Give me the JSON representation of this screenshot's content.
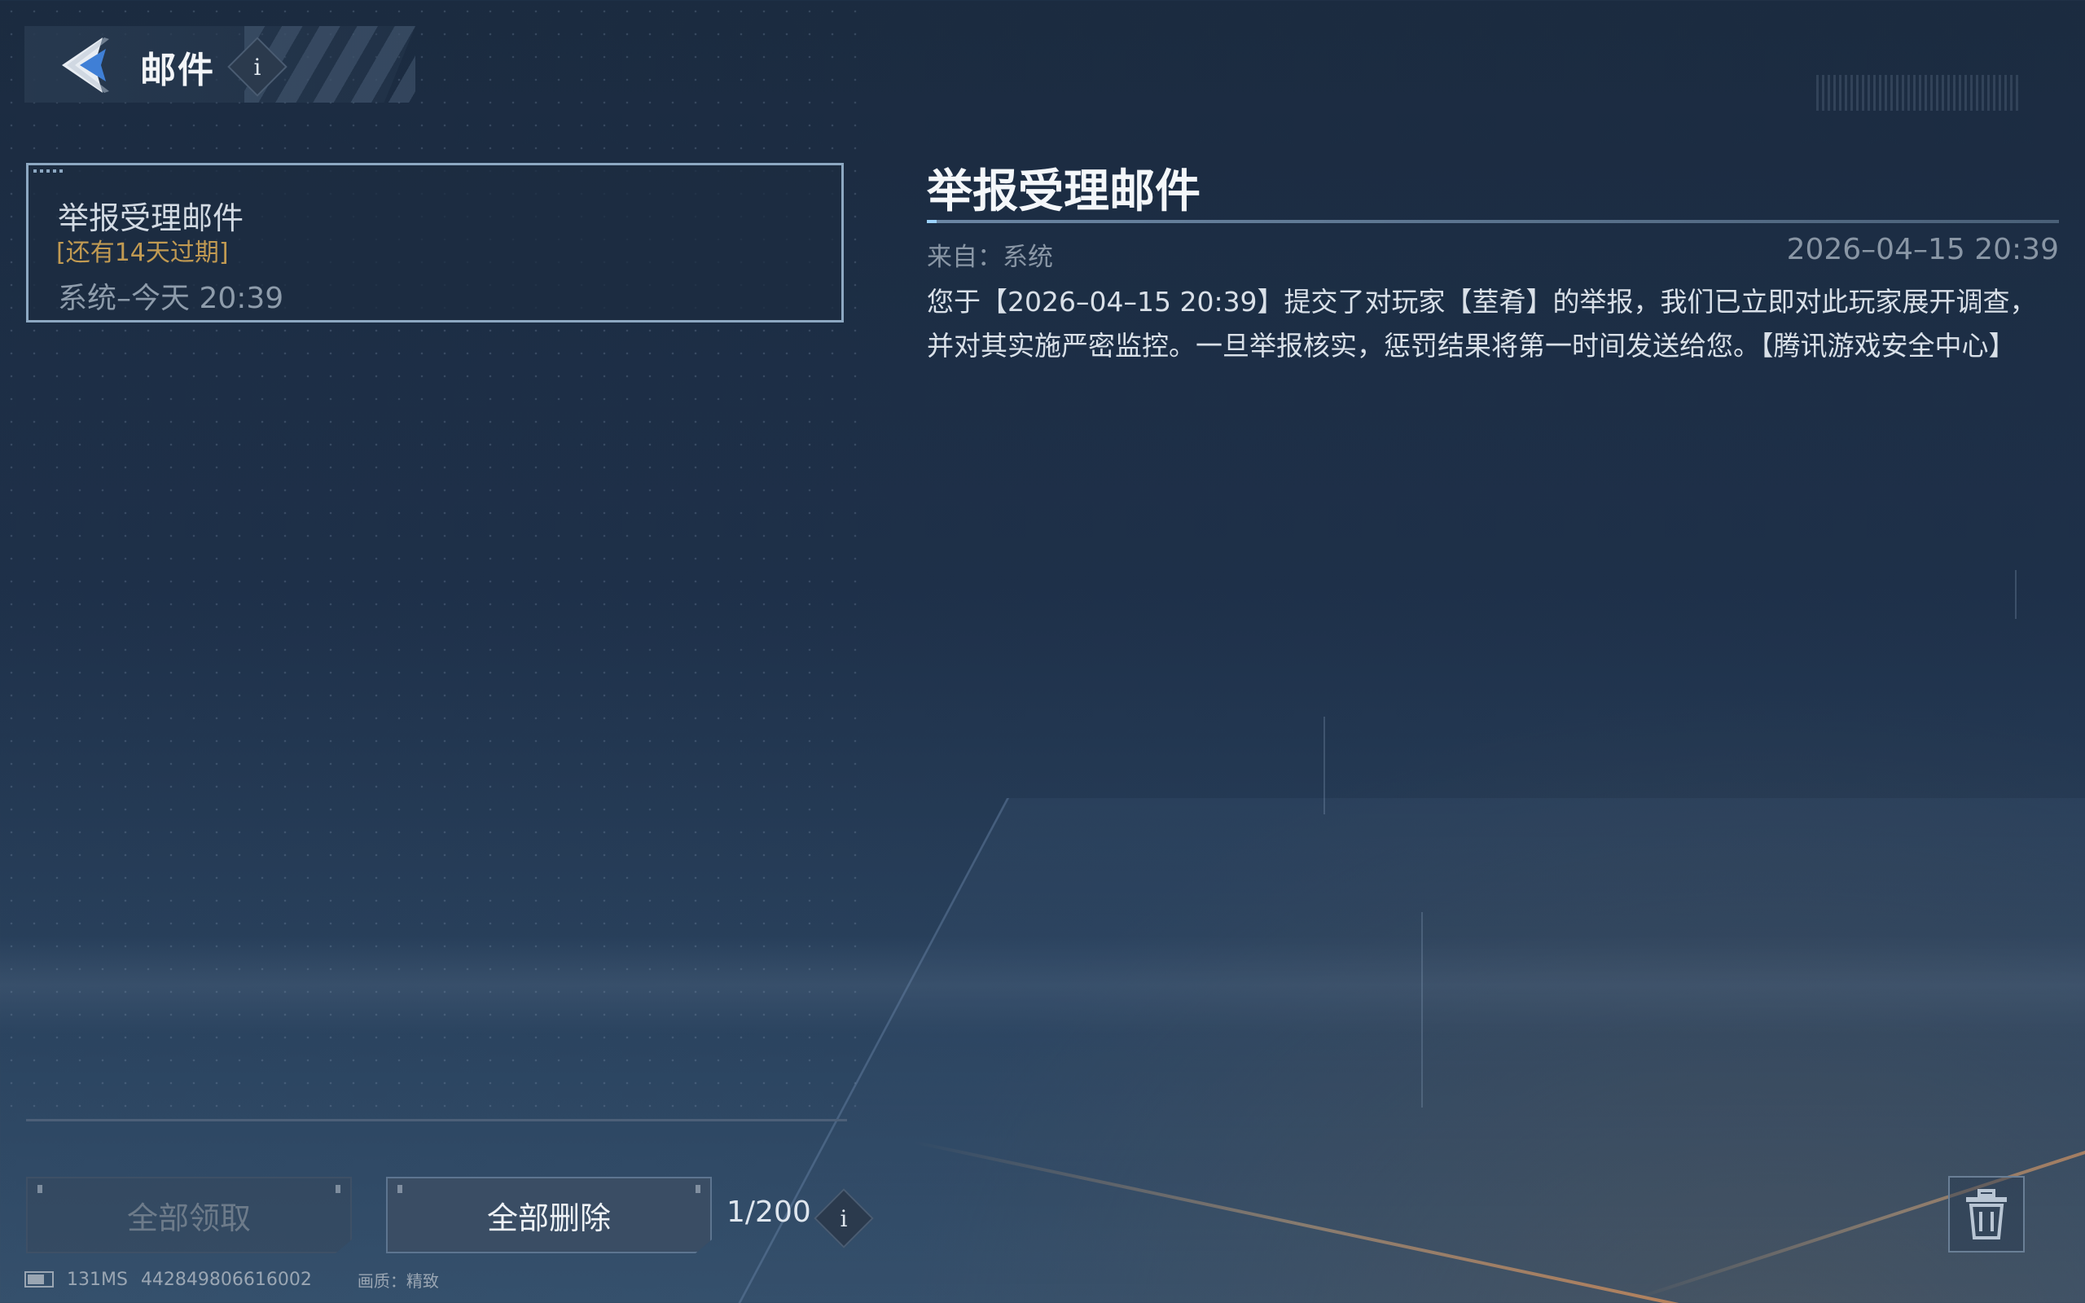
{
  "header": {
    "title": "邮件",
    "info_label": "i"
  },
  "mail_list": {
    "items": [
      {
        "title": "举报受理邮件",
        "expire": "[还有14天过期]",
        "meta": "系统–今天 20:39"
      }
    ]
  },
  "footer": {
    "claim_all_label": "全部领取",
    "delete_all_label": "全部删除",
    "count": "1/200",
    "info_label": "i"
  },
  "detail": {
    "title": "举报受理邮件",
    "from": "来自：系统",
    "date": "2026–04–15 20:39",
    "body": "您于【2026–04–15 20:39】提交了对玩家【荎肴】的举报，我们已立即对此玩家展开调查，并对其实施严密监控。一旦举报核实，惩罚结果将第一时间发送给您。【腾讯游戏安全中心】"
  },
  "status_bar": {
    "ping": "131MS",
    "uid": "442849806616002",
    "quality": "画质：精致"
  },
  "colors": {
    "accent": "#4f8ad8",
    "expire": "#c19a52",
    "selected_border": "#8da8c2"
  },
  "icons": [
    "back-arrow-icon",
    "info-icon",
    "trash-icon",
    "battery-icon"
  ]
}
